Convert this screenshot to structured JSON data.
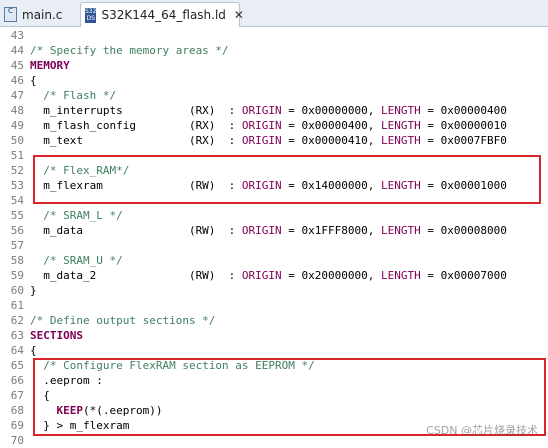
{
  "tabs": [
    {
      "label": "main.c",
      "icon": "c-file-icon",
      "active": false
    },
    {
      "label": "S32K144_64_flash.ld",
      "icon": "ld-file-icon",
      "active": true,
      "icon_text": "S32 DS"
    }
  ],
  "close_glyph": "✕",
  "lines": [
    {
      "n": "43",
      "fold": "",
      "code": []
    },
    {
      "n": "44",
      "fold": "",
      "code": [
        [
          "cm",
          "/* Specify the memory areas */"
        ]
      ]
    },
    {
      "n": "45",
      "fold": "",
      "code": [
        [
          "kw",
          "MEMORY"
        ]
      ]
    },
    {
      "n": "46",
      "fold": "",
      "code": [
        [
          "tx",
          "{"
        ]
      ]
    },
    {
      "n": "47",
      "fold": "",
      "code": [
        [
          "tx",
          "  "
        ],
        [
          "cm",
          "/* Flash */"
        ]
      ]
    },
    {
      "n": "48",
      "fold": "",
      "code": [
        [
          "tx",
          "  m_interrupts          (RX)  : "
        ],
        [
          "pl",
          "ORIGIN"
        ],
        [
          "tx",
          " = 0x00000000, "
        ],
        [
          "pl",
          "LENGTH"
        ],
        [
          "tx",
          " = 0x00000400"
        ]
      ]
    },
    {
      "n": "49",
      "fold": "",
      "code": [
        [
          "tx",
          "  m_flash_config        (RX)  : "
        ],
        [
          "pl",
          "ORIGIN"
        ],
        [
          "tx",
          " = 0x00000400, "
        ],
        [
          "pl",
          "LENGTH"
        ],
        [
          "tx",
          " = 0x00000010"
        ]
      ]
    },
    {
      "n": "50",
      "fold": "",
      "code": [
        [
          "tx",
          "  m_text                (RX)  : "
        ],
        [
          "pl",
          "ORIGIN"
        ],
        [
          "tx",
          " = 0x00000410, "
        ],
        [
          "pl",
          "LENGTH"
        ],
        [
          "tx",
          " = 0x0007FBF0"
        ]
      ]
    },
    {
      "n": "51",
      "fold": "",
      "code": []
    },
    {
      "n": "52",
      "fold": "",
      "code": [
        [
          "tx",
          "  "
        ],
        [
          "cm",
          "/* Flex_RAM*/"
        ]
      ]
    },
    {
      "n": "53",
      "fold": "",
      "code": [
        [
          "tx",
          "  m_flexram             (RW)  : "
        ],
        [
          "pl",
          "ORIGIN"
        ],
        [
          "tx",
          " = 0x14000000, "
        ],
        [
          "pl",
          "LENGTH"
        ],
        [
          "tx",
          " = 0x00001000"
        ]
      ]
    },
    {
      "n": "54",
      "fold": "",
      "code": []
    },
    {
      "n": "55",
      "fold": "",
      "code": [
        [
          "tx",
          "  "
        ],
        [
          "cm",
          "/* SRAM_L */"
        ]
      ]
    },
    {
      "n": "56",
      "fold": "",
      "code": [
        [
          "tx",
          "  m_data                (RW)  : "
        ],
        [
          "pl",
          "ORIGIN"
        ],
        [
          "tx",
          " = 0x1FFF8000, "
        ],
        [
          "pl",
          "LENGTH"
        ],
        [
          "tx",
          " = 0x00008000"
        ]
      ]
    },
    {
      "n": "57",
      "fold": "",
      "code": []
    },
    {
      "n": "58",
      "fold": "",
      "code": [
        [
          "tx",
          "  "
        ],
        [
          "cm",
          "/* SRAM_U */"
        ]
      ]
    },
    {
      "n": "59",
      "fold": "",
      "code": [
        [
          "tx",
          "  m_data_2              (RW)  : "
        ],
        [
          "pl",
          "ORIGIN"
        ],
        [
          "tx",
          " = 0x20000000, "
        ],
        [
          "pl",
          "LENGTH"
        ],
        [
          "tx",
          " = 0x00007000"
        ]
      ]
    },
    {
      "n": "60",
      "fold": "",
      "code": [
        [
          "tx",
          "}"
        ]
      ]
    },
    {
      "n": "61",
      "fold": "",
      "code": []
    },
    {
      "n": "62",
      "fold": "",
      "code": [
        [
          "cm",
          "/* Define output sections */"
        ]
      ]
    },
    {
      "n": "63",
      "fold": "",
      "code": [
        [
          "kw",
          "SECTIONS"
        ]
      ]
    },
    {
      "n": "64",
      "fold": "",
      "code": [
        [
          "tx",
          "{"
        ]
      ]
    },
    {
      "n": "65",
      "fold": "",
      "code": [
        [
          "tx",
          "  "
        ],
        [
          "cm",
          "/* Configure FlexRAM section as EEPROM */"
        ]
      ]
    },
    {
      "n": "66",
      "fold": "",
      "code": [
        [
          "tx",
          "  .eeprom :"
        ]
      ]
    },
    {
      "n": "67",
      "fold": "",
      "code": [
        [
          "tx",
          "  {"
        ]
      ]
    },
    {
      "n": "68",
      "fold": "",
      "code": [
        [
          "tx",
          "    "
        ],
        [
          "kw",
          "KEEP"
        ],
        [
          "tx",
          "(*(.eeprom))"
        ]
      ]
    },
    {
      "n": "69",
      "fold": "",
      "code": [
        [
          "tx",
          "  } > m_flexram"
        ]
      ]
    },
    {
      "n": "70",
      "fold": "",
      "code": []
    }
  ],
  "colors": {
    "comment": "#3f7f5f",
    "keyword": "#7f0055",
    "highlight_box": "#d9262a"
  },
  "watermark": "CSDN @芯片烧录技术"
}
